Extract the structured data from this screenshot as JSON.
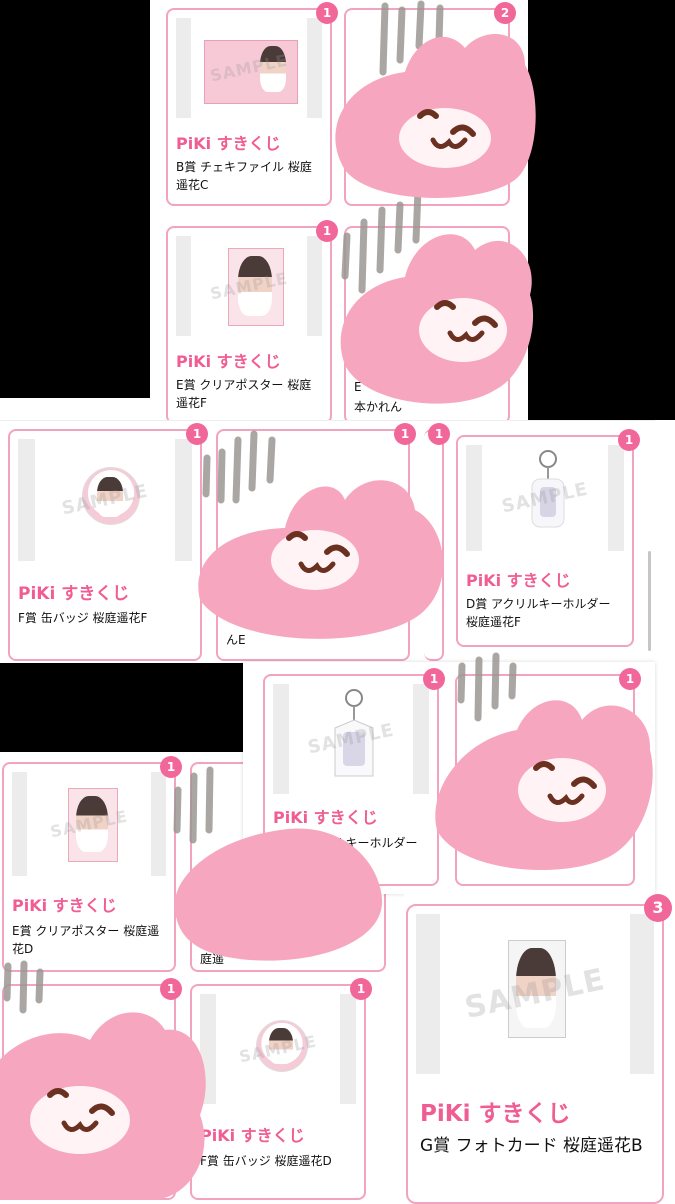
{
  "cards": [
    {
      "brand": "PiKi すきくじ",
      "title": "B賞 チェキファイル 桜庭遥花C",
      "count": "1"
    },
    {
      "brand": "",
      "title": "",
      "count": "2"
    },
    {
      "brand": "PiKi すきくじ",
      "title": "E賞 クリアポスター 桜庭遥花F",
      "count": "1"
    },
    {
      "brand": "",
      "title": "E賞 クリアポスター 橋本かれん",
      "visible_fragment": "E",
      "count": "1"
    },
    {
      "brand": "PiKi すきくじ",
      "title": "F賞 缶バッジ 桜庭遥花F",
      "count": "1"
    },
    {
      "brand": "",
      "title": "んE",
      "count": "1"
    },
    {
      "brand": "",
      "title": "",
      "count": "1"
    },
    {
      "brand": "PiKi すきくじ",
      "title": "D賞 アクリルキーホルダー 桜庭遥花F",
      "count": "1"
    },
    {
      "brand": "PiKi すきくじ",
      "title": "D賞 アクリルキーホルダー 桜庭遥花C",
      "count": "1"
    },
    {
      "brand": "",
      "title": "",
      "count": "1"
    },
    {
      "brand": "PiKi すきくじ",
      "title": "E賞 クリアポスター 桜庭遥花D",
      "count": "1"
    },
    {
      "brand": "",
      "title": "庭遥",
      "count": ""
    },
    {
      "brand": "",
      "title": "",
      "count": "1"
    },
    {
      "brand": "PiKi すきくじ",
      "title": "F賞 缶バッジ 桜庭遥花D",
      "count": "1"
    },
    {
      "brand": "PiKi すきくじ",
      "title": "G賞 フォトカード 桜庭遥花B",
      "count": "3"
    }
  ],
  "texts": {
    "sample": "SAMPLE",
    "fragment_b": "本かれん",
    "fragment_c": "庭遥"
  },
  "colors": {
    "brand": "#f05d92",
    "badge": "#f2679a",
    "border": "#f2a3bf",
    "bunny": "#f7a6c0"
  }
}
